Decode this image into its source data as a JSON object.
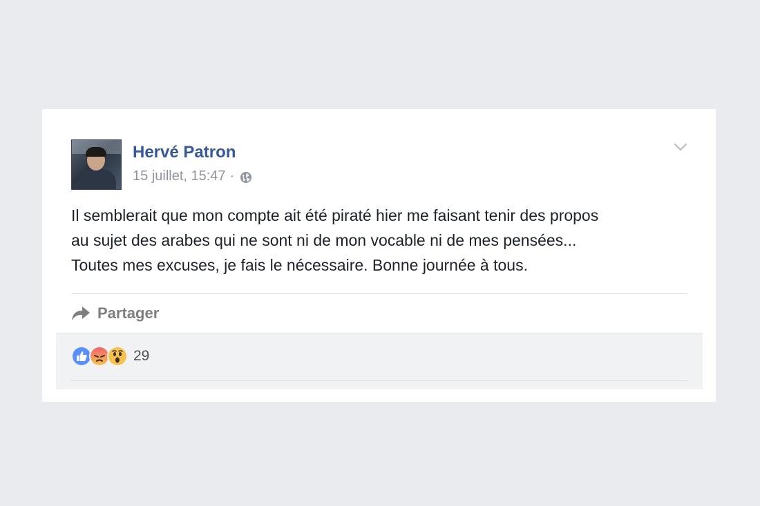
{
  "post": {
    "author": "Hervé Patron",
    "timestamp": "15 juillet, 15:47",
    "separator": "·",
    "audience_icon": "globe-icon",
    "menu_icon": "chevron-down-icon",
    "text_lines": [
      "Il semblerait que mon compte ait été piraté hier me faisant tenir des propos",
      "au sujet des arabes qui ne sont ni de mon vocable ni de mes pensées...",
      "Toutes mes excuses, je fais le nécessaire. Bonne journée à tous."
    ]
  },
  "actions": {
    "share_label": "Partager",
    "share_icon": "share-arrow-icon"
  },
  "reactions": {
    "types": [
      "like",
      "angry",
      "wow"
    ],
    "count": "29"
  },
  "colors": {
    "page_background": "#e9ebee",
    "author_link": "#365899",
    "meta_text": "#90949c",
    "body_text": "#1d2129",
    "share_text": "#7f7f7f",
    "like_blue": "#5890ff",
    "angry_top": "#f1626d",
    "angry_bottom": "#f7c24b",
    "wow_yellow": "#f7c24b"
  }
}
